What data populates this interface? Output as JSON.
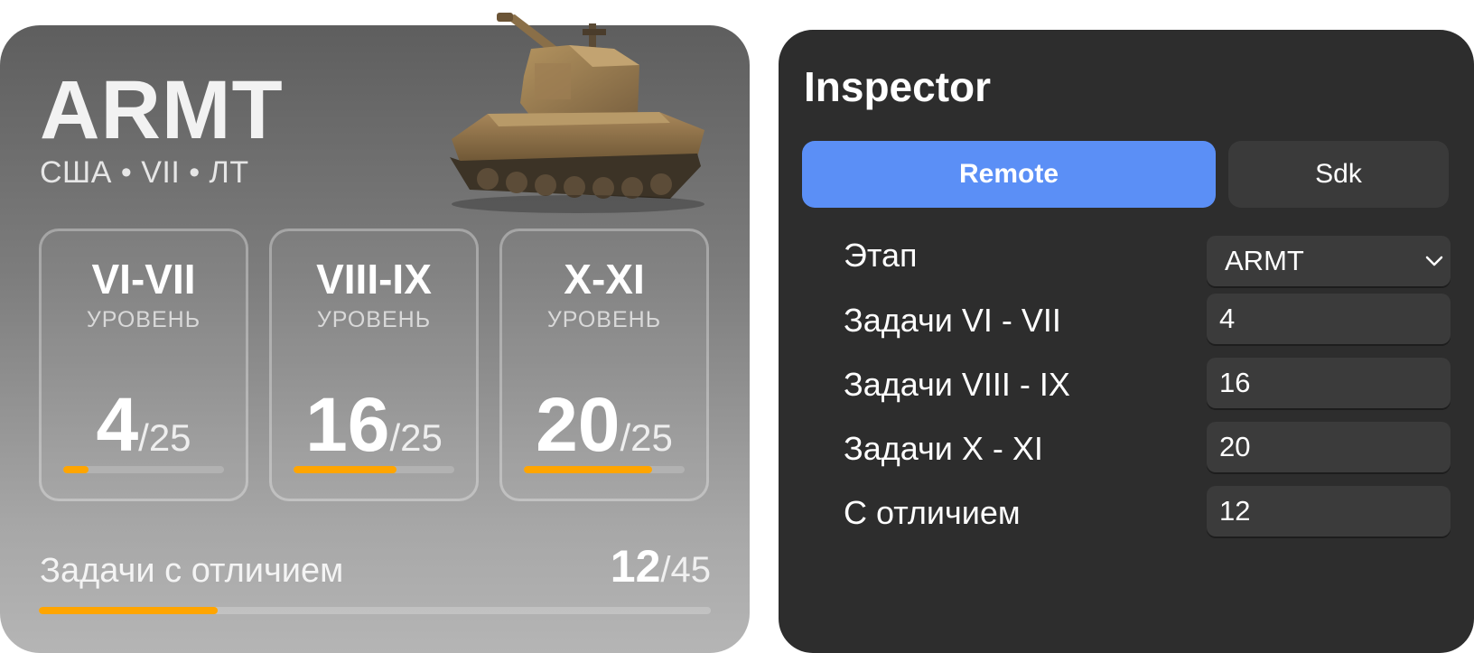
{
  "card": {
    "title": "ARMT",
    "subtitle": "США • VII • ЛТ",
    "tiers": [
      {
        "name": "VI-VII",
        "sub": "УРОВЕНЬ",
        "done": "4",
        "total": "/25",
        "progress": 0.16
      },
      {
        "name": "VIII-IX",
        "sub": "УРОВЕНЬ",
        "done": "16",
        "total": "/25",
        "progress": 0.64
      },
      {
        "name": "X-XI",
        "sub": "УРОВЕНЬ",
        "done": "20",
        "total": "/25",
        "progress": 0.8
      }
    ],
    "honor": {
      "label": "Задачи с отличием",
      "done": "12",
      "total": "/45",
      "progress": 0.2667
    }
  },
  "inspector": {
    "title": "Inspector",
    "tabs": [
      {
        "label": "Remote",
        "active": true
      },
      {
        "label": "Sdk",
        "active": false
      }
    ],
    "rows": [
      {
        "label": "Этап",
        "value": "ARMT",
        "kind": "select"
      },
      {
        "label": "Задачи VI - VII",
        "value": "4",
        "kind": "input"
      },
      {
        "label": "Задачи VIII - IX",
        "value": "16",
        "kind": "input"
      },
      {
        "label": "Задачи X - XI",
        "value": "20",
        "kind": "input"
      },
      {
        "label": "С отличием",
        "value": "12",
        "kind": "input"
      }
    ]
  },
  "colors": {
    "accent_orange": "#ffa500",
    "tab_active": "#5b8ff6",
    "panel_bg": "#2d2d2d",
    "field_bg": "#3b3b3b"
  },
  "icons": {
    "tank": "tank-image",
    "dropdown": "chevron-down-icon"
  }
}
